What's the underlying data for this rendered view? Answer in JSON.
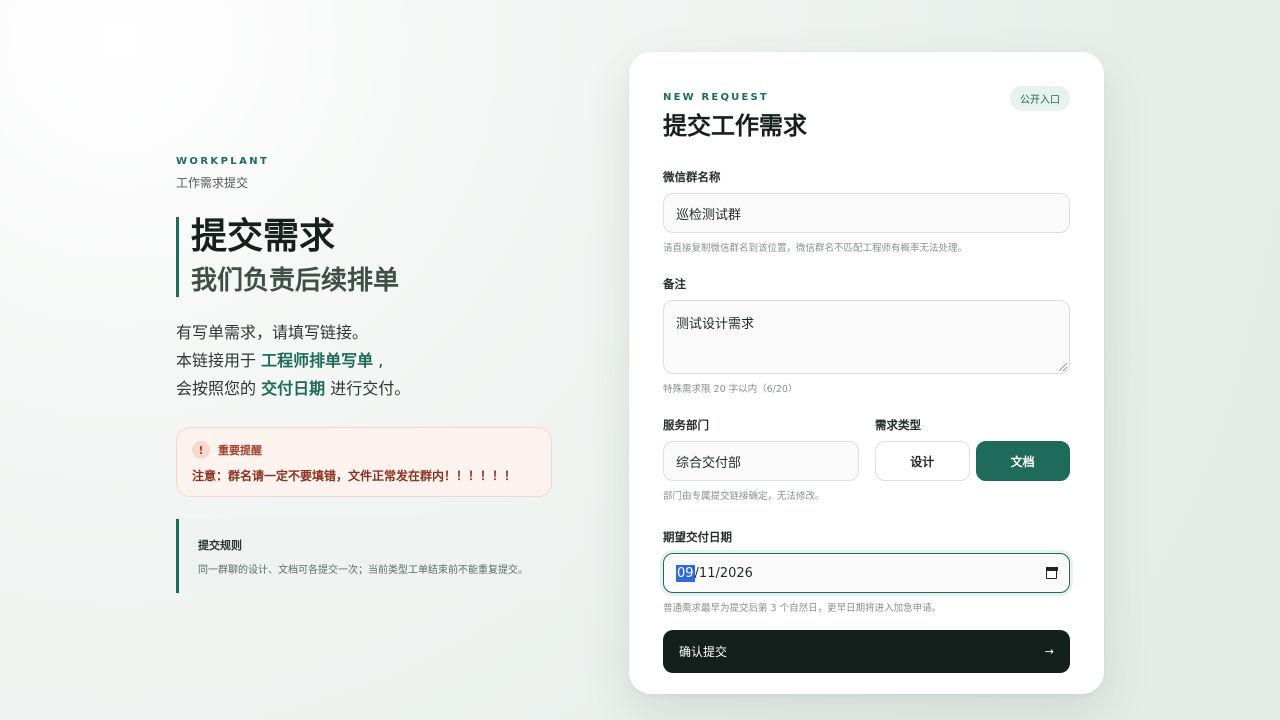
{
  "brand": {
    "name": "WORKPLANT",
    "subtitle": "工作需求提交"
  },
  "hero": {
    "title": "提交需求",
    "subtitle": "我们负责后续排单"
  },
  "description": {
    "line1": "有写单需求，请填写链接。",
    "line2_prefix": "本链接用于 ",
    "line2_emphasis": "工程师排单写单",
    "line2_suffix": " ,",
    "line3_prefix": "会按照您的 ",
    "line3_emphasis": "交付日期",
    "line3_suffix": " 进行交付。"
  },
  "alert": {
    "icon": "!",
    "title": "重要提醒",
    "text": "注意：群名请一定不要填错，文件正常发在群内！！！！！！"
  },
  "rules": {
    "title": "提交规则",
    "text": "同一群聊的设计、文档可各提交一次；当前类型工单结束前不能重复提交。"
  },
  "form": {
    "eyebrow": "NEW REQUEST",
    "badge": "公开入口",
    "title": "提交工作需求",
    "group_name": {
      "label": "微信群名称",
      "value": "巡检测试群",
      "hint": "请直接复制微信群名到该位置，微信群名不匹配工程师有概率无法处理。"
    },
    "notes": {
      "label": "备注",
      "value": "测试设计需求",
      "hint": "特殊需求限 20 字以内（6/20）"
    },
    "department": {
      "label": "服务部门",
      "value": "综合交付部",
      "hint": "部门由专属提交链接确定，无法修改。"
    },
    "request_type": {
      "label": "需求类型",
      "options": [
        "设计",
        "文档"
      ],
      "selected": "文档"
    },
    "due_date": {
      "label": "期望交付日期",
      "month": "09",
      "rest": "/11/2026",
      "hint": "普通需求最早为提交后第 3 个自然日，更早日期将进入加急申请。"
    },
    "submit": {
      "label": "确认提交",
      "arrow": "→"
    }
  },
  "colors": {
    "accent": "#1d6b58",
    "dark_button": "#14201c",
    "alert_text": "#8a3220"
  }
}
